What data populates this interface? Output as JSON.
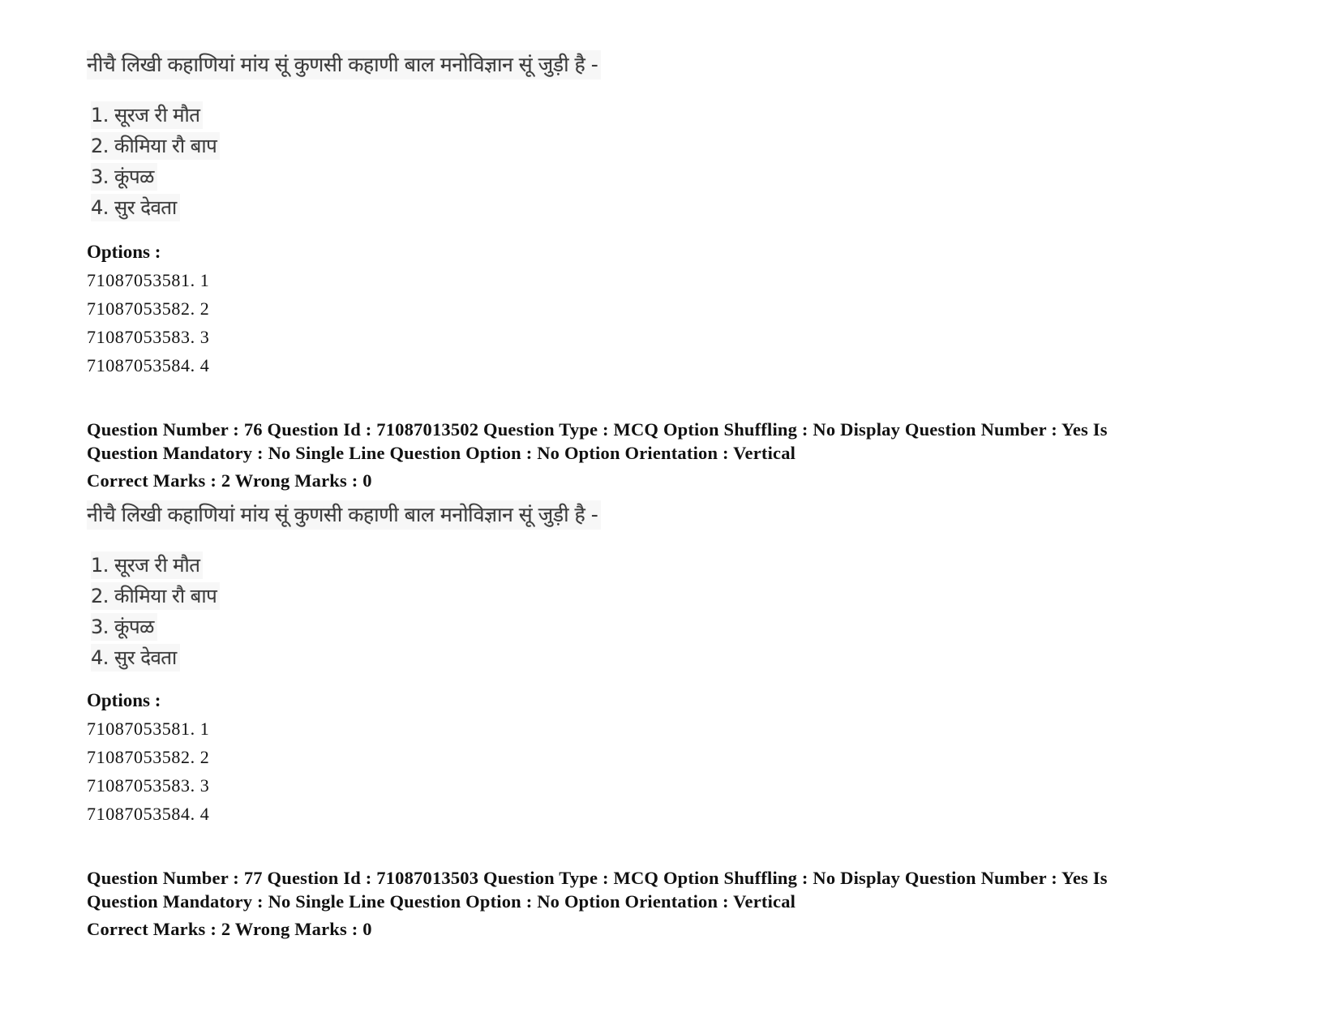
{
  "blocks": [
    {
      "question_text": "नीचै लिखी कहाणियां मांय सूं कुणसी कहाणी बाल मनोविज्ञान सूं जुड़ी है -",
      "list_items": [
        "1. सूरज री मौत",
        "2. कीमिया रौ बाप",
        "3. कूंपळ",
        "4. सुर देवता"
      ],
      "options_label": "Options :",
      "options": [
        "71087053581. 1",
        "71087053582. 2",
        "71087053583. 3",
        "71087053584. 4"
      ]
    },
    {
      "header_line1": "Question Number : 76 Question Id : 71087013502 Question Type : MCQ Option Shuffling : No Display Question Number : Yes Is",
      "header_line2": "Question Mandatory : No Single Line Question Option : No Option Orientation : Vertical",
      "marks": "Correct Marks : 2 Wrong Marks : 0",
      "question_text": "नीचै लिखी कहाणियां मांय सूं कुणसी कहाणी बाल मनोविज्ञान सूं जुड़ी है -",
      "list_items": [
        "1. सूरज री मौत",
        "2. कीमिया रौ बाप",
        "3. कूंपळ",
        "4. सुर देवता"
      ],
      "options_label": "Options :",
      "options": [
        "71087053581. 1",
        "71087053582. 2",
        "71087053583. 3",
        "71087053584. 4"
      ]
    },
    {
      "header_line1": "Question Number : 77 Question Id : 71087013503 Question Type : MCQ Option Shuffling : No Display Question Number : Yes Is",
      "header_line2": "Question Mandatory : No Single Line Question Option : No Option Orientation : Vertical",
      "marks": "Correct Marks : 2 Wrong Marks : 0"
    }
  ]
}
